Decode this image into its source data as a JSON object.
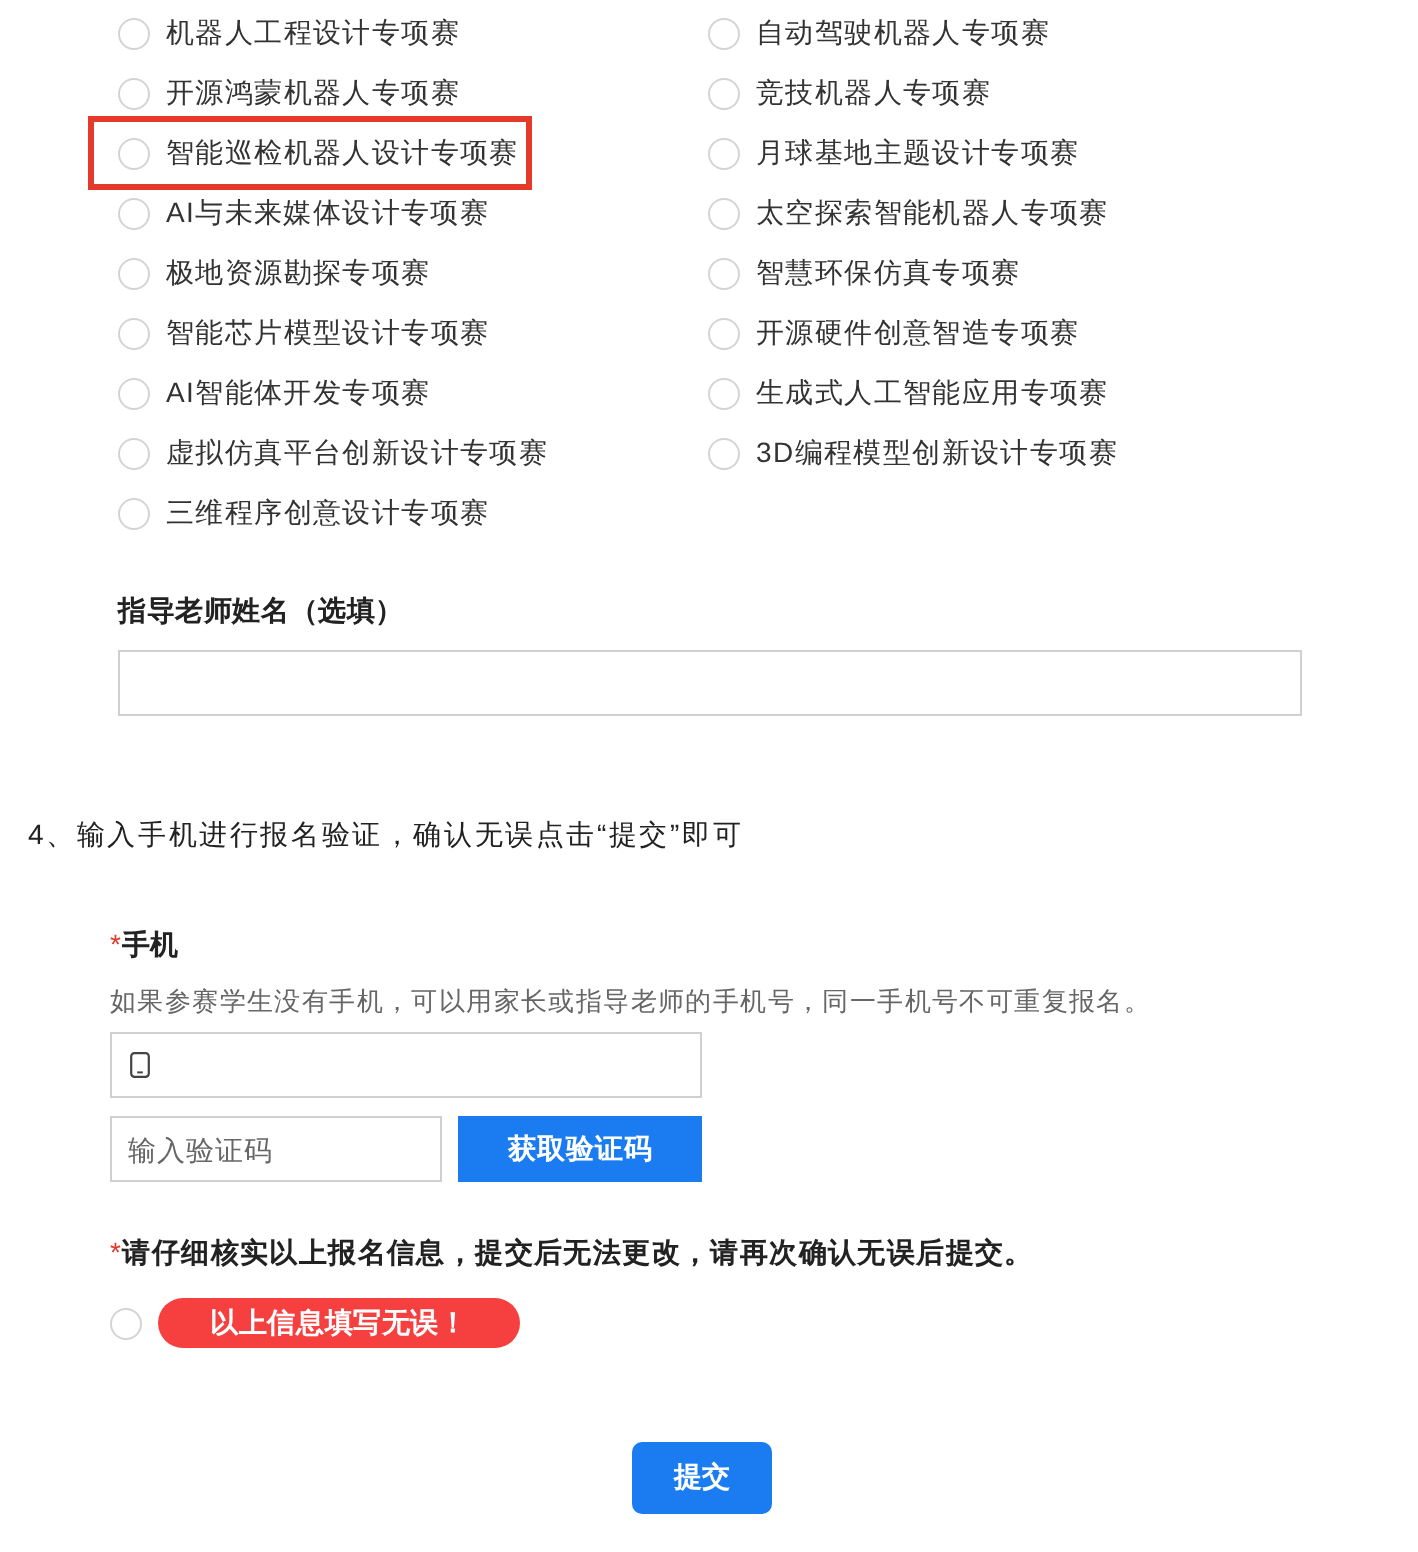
{
  "options": [
    {
      "label": "机器人工程设计专项赛",
      "selected": false,
      "highlighted": false
    },
    {
      "label": "自动驾驶机器人专项赛",
      "selected": false,
      "highlighted": false
    },
    {
      "label": "开源鸿蒙机器人专项赛",
      "selected": false,
      "highlighted": false
    },
    {
      "label": "竞技机器人专项赛",
      "selected": false,
      "highlighted": false
    },
    {
      "label": "智能巡检机器人设计专项赛",
      "selected": false,
      "highlighted": true
    },
    {
      "label": "月球基地主题设计专项赛",
      "selected": false,
      "highlighted": false
    },
    {
      "label": "AI与未来媒体设计专项赛",
      "selected": false,
      "highlighted": false
    },
    {
      "label": "太空探索智能机器人专项赛",
      "selected": false,
      "highlighted": false
    },
    {
      "label": "极地资源勘探专项赛",
      "selected": false,
      "highlighted": false
    },
    {
      "label": "智慧环保仿真专项赛",
      "selected": false,
      "highlighted": false
    },
    {
      "label": "智能芯片模型设计专项赛",
      "selected": false,
      "highlighted": false
    },
    {
      "label": "开源硬件创意智造专项赛",
      "selected": false,
      "highlighted": false
    },
    {
      "label": "AI智能体开发专项赛",
      "selected": false,
      "highlighted": false
    },
    {
      "label": "生成式人工智能应用专项赛",
      "selected": false,
      "highlighted": false
    },
    {
      "label": "虚拟仿真平台创新设计专项赛",
      "selected": false,
      "highlighted": false
    },
    {
      "label": "3D编程模型创新设计专项赛",
      "selected": false,
      "highlighted": false
    },
    {
      "label": "三维程序创意设计专项赛",
      "selected": false,
      "highlighted": false
    }
  ],
  "teacher_name": {
    "label": "指导老师姓名（选填）"
  },
  "step_instruction": "4、输入手机进行报名验证，确认无误点击“提交”即可",
  "phone": {
    "required_mark": "*",
    "label": "手机",
    "hint": "如果参赛学生没有手机，可以用家长或指导老师的手机号，同一手机号不可重复报名。",
    "code_placeholder": "输入验证码",
    "code_button": "获取验证码"
  },
  "confirmation": {
    "required_mark": "*",
    "notice": "请仔细核实以上报名信息，提交后无法更改，请再次确认无误后提交。",
    "checked": false,
    "label": "以上信息填写无误！"
  },
  "submit_button": "提交"
}
